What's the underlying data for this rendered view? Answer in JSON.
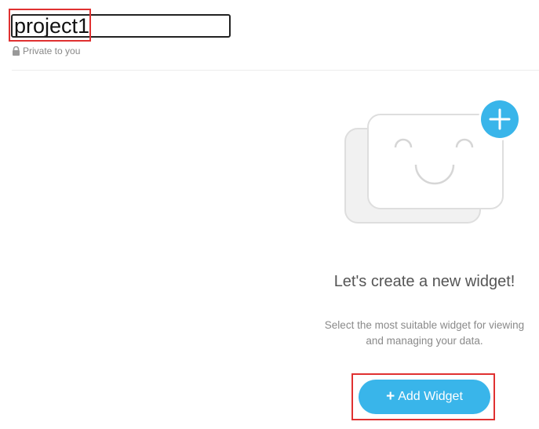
{
  "project": {
    "title_value": "project1",
    "privacy_text": "Private to you"
  },
  "empty_state": {
    "title": "Let's create a new widget!",
    "description_line1": "Select the most suitable widget for viewing",
    "description_line2": "and managing your data.",
    "add_button_icon": "+",
    "add_button_label": "Add Widget"
  },
  "icons": {
    "lock": "lock-icon",
    "plus": "plus-icon",
    "illustration": "widget-smiley-illustration"
  },
  "colors": {
    "accent": "#39b5ea",
    "highlight": "#e03131",
    "muted_text": "#8a8a8a"
  }
}
